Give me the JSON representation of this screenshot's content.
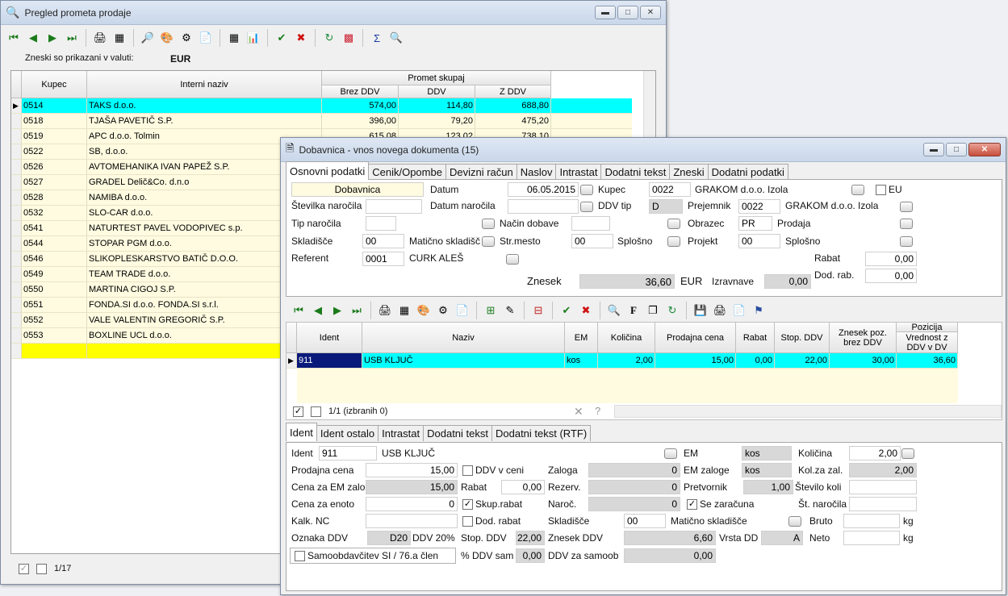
{
  "win1": {
    "title": "Pregled prometa prodaje",
    "currency_label": "Zneski so prikazani v valuti:",
    "currency": "EUR",
    "headers": {
      "kupec": "Kupec",
      "naziv": "Interni naziv",
      "group": "Promet skupaj",
      "brez": "Brez DDV",
      "ddv": "DDV",
      "z": "Z DDV"
    },
    "rows": [
      {
        "kupec": "0514",
        "naziv": "TAKS d.o.o.",
        "brez": "574,00",
        "ddv": "114,80",
        "z": "688,80"
      },
      {
        "kupec": "0518",
        "naziv": "TJAŠA PAVETIČ S.P.",
        "brez": "396,00",
        "ddv": "79,20",
        "z": "475,20"
      },
      {
        "kupec": "0519",
        "naziv": "APC d.o.o. Tolmin",
        "brez": "615,08",
        "ddv": "123,02",
        "z": "738,10"
      },
      {
        "kupec": "0522",
        "naziv": "SB, d.o.o.",
        "brez": "",
        "ddv": "",
        "z": ""
      },
      {
        "kupec": "0526",
        "naziv": "AVTOMEHANIKA IVAN PAPEŽ S.P.",
        "brez": "",
        "ddv": "",
        "z": ""
      },
      {
        "kupec": "0527",
        "naziv": "GRADEL Delič&Co. d.n.o",
        "brez": "",
        "ddv": "",
        "z": ""
      },
      {
        "kupec": "0528",
        "naziv": "NAMIBA d.o.o.",
        "brez": "",
        "ddv": "",
        "z": ""
      },
      {
        "kupec": "0532",
        "naziv": "SLO-CAR d.o.o.",
        "brez": "",
        "ddv": "",
        "z": ""
      },
      {
        "kupec": "0541",
        "naziv": "NATURTEST PAVEL VODOPIVEC s.p.",
        "brez": "",
        "ddv": "",
        "z": ""
      },
      {
        "kupec": "0544",
        "naziv": "STOPAR PGM d.o.o.",
        "brez": "",
        "ddv": "",
        "z": ""
      },
      {
        "kupec": "0546",
        "naziv": "SLIKOPLESKARSTVO BATIČ D.O.O.",
        "brez": "",
        "ddv": "",
        "z": ""
      },
      {
        "kupec": "0549",
        "naziv": "TEAM TRADE d.o.o.",
        "brez": "",
        "ddv": "",
        "z": ""
      },
      {
        "kupec": "0550",
        "naziv": "MARTINA CIGOJ S.P.",
        "brez": "",
        "ddv": "",
        "z": ""
      },
      {
        "kupec": "0551",
        "naziv": "FONDA.SI d.o.o. FONDA.SI s.r.l.",
        "brez": "",
        "ddv": "",
        "z": ""
      },
      {
        "kupec": "0552",
        "naziv": "VALE VALENTIN GREGORIČ S.P.",
        "brez": "",
        "ddv": "",
        "z": ""
      },
      {
        "kupec": "0553",
        "naziv": "BOXLINE UCL d.o.o.",
        "brez": "",
        "ddv": "",
        "z": ""
      }
    ],
    "footer_count": "1/17"
  },
  "win2": {
    "title": "Dobavnica - vnos novega dokumenta (15)",
    "tabs": [
      "Osnovni podatki",
      "Cenik/Opombe",
      "Devizni račun",
      "Naslov",
      "Intrastat",
      "Dodatni tekst",
      "Zneski",
      "Dodatni podatki"
    ],
    "doc_type": "Dobavnica",
    "labels": {
      "datum": "Datum",
      "kupec": "Kupec",
      "eu": "EU",
      "stev_nar": "Številka naročila",
      "datum_nar": "Datum naročila",
      "ddv_tip": "DDV tip",
      "prejemnik": "Prejemnik",
      "tip_nar": "Tip naročila",
      "nacin_dob": "Način dobave",
      "obrazec": "Obrazec",
      "skladisce": "Skladišče",
      "maticno": "Matično skladišče",
      "strmesto": "Str.mesto",
      "splosno": "Splošno",
      "projekt": "Projekt",
      "referent": "Referent",
      "rabat": "Rabat",
      "znesek": "Znesek",
      "izravnave": "Izravnave",
      "dodrab": "Dod. rab."
    },
    "values": {
      "datum": "06.05.2015",
      "kupec": "0022",
      "kupec_name": "GRAKOM d.o.o. Izola",
      "ddv_tip": "D",
      "prejemnik": "0022",
      "prejemnik_name": "GRAKOM d.o.o. Izola",
      "obrazec": "PR",
      "obrazec_name": "Prodaja",
      "skladisce": "00",
      "strmesto": "00",
      "projekt": "00",
      "referent": "0001",
      "referent_name": "CURK ALEŠ",
      "rabat": "0,00",
      "znesek": "36,60",
      "currency": "EUR",
      "izravnave": "0,00",
      "dodrab": "0,00"
    },
    "items_headers": {
      "ident": "Ident",
      "naziv": "Naziv",
      "em": "EM",
      "kolicina": "Količina",
      "cena": "Prodajna cena",
      "rabat": "Rabat",
      "stopddv": "Stop. DDV",
      "zbrez": "Znesek poz. brez DDV",
      "poz": "Pozicija",
      "vred": "Vrednost z DDV v DV"
    },
    "item": {
      "ident": "911",
      "naziv": "USB KLJUČ",
      "em": "kos",
      "kolicina": "2,00",
      "cena": "15,00",
      "rabat": "0,00",
      "stopddv": "22,00",
      "zbrez": "30,00",
      "vred": "36,60"
    },
    "items_status": "1/1 (izbranih 0)",
    "tabs2": [
      "Ident",
      "Ident ostalo",
      "Intrastat",
      "Dodatni tekst",
      "Dodatni tekst (RTF)"
    ],
    "detail_labels": {
      "ident": "Ident",
      "em": "EM",
      "kolicina": "Količina",
      "prodcena": "Prodajna cena",
      "ddvvceni": "DDV v ceni",
      "zaloga": "Zaloga",
      "emzaloge": "EM zaloge",
      "kolzazal": "Kol.za zal.",
      "cenazaem": "Cena za EM zalo",
      "rabat": "Rabat",
      "rezerv": "Rezerv.",
      "pretvornik": "Pretvornik",
      "stkoli": "Število koli",
      "cenazaenoto": "Cena za enoto",
      "skuprabat": "Skup.rabat",
      "naroc": "Naroč.",
      "sezaracuna": "Se zaračuna",
      "stnarocila": "Št. naročila",
      "kalknc": "Kalk. NC",
      "dodrabat": "Dod. rabat",
      "skladisce": "Skladišče",
      "maticno": "Matično skladišče",
      "bruto": "Bruto",
      "kg": "kg",
      "oznakaddv": "Oznaka DDV",
      "ddv20": "DDV 20%",
      "stopddv": "Stop. DDV",
      "znesekddv": "Znesek DDV",
      "vrstadd": "Vrsta DD",
      "neto": "Neto",
      "samoobd": "Samoobdavčitev SI / 76.a člen",
      "pddvsam": "% DDV sam",
      "ddvzasam": "DDV za samoob"
    },
    "detail_values": {
      "ident": "911",
      "naziv": "USB KLJUČ",
      "em": "kos",
      "kolicina": "2,00",
      "prodcena": "15,00",
      "zaloga": "0",
      "emzaloge": "kos",
      "kolzazal": "2,00",
      "cenazaem": "15,00",
      "rabat": "0,00",
      "rezerv": "0",
      "pretvornik": "1,00",
      "cenazaenoto": "0",
      "naroc": "0",
      "skladisce": "00",
      "oznakaddv": "D20",
      "stopddv": "22,00",
      "znesekddv": "6,60",
      "vrstadd": "A",
      "pddvsam": "0,00",
      "ddvzasam": "0,00"
    }
  }
}
